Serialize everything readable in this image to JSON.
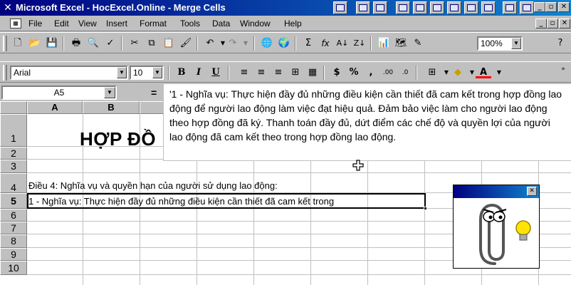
{
  "window": {
    "title": "Microsoft Excel - HocExcel.Online - Merge Cells"
  },
  "menu": {
    "items": [
      "File",
      "Edit",
      "View",
      "Insert",
      "Format",
      "Tools",
      "Data",
      "Window",
      "Help"
    ],
    "accels": [
      "F",
      "E",
      "V",
      "I",
      "o",
      "T",
      "D",
      "W",
      "H"
    ]
  },
  "standard_toolbar": {
    "zoom": "100%"
  },
  "formatting_toolbar": {
    "font_name": "Arial",
    "font_size": "10",
    "bold": "B",
    "italic": "I",
    "underline": "U",
    "currency": "$",
    "percent": "%",
    "comma": ","
  },
  "formula_bar": {
    "name_box": "A5",
    "equals": "="
  },
  "sheet": {
    "columns": [
      "A",
      "B"
    ],
    "rows": [
      "1",
      "2",
      "3",
      "4",
      "5",
      "6",
      "7",
      "8",
      "9",
      "10"
    ],
    "active_row": "5",
    "title_cell": "HỢP ĐỒ",
    "row4_text": "Điều 4: Nghĩa vụ và quyền hạn của người sử dụng lao động:",
    "row5_text": "1 - Nghĩa vụ: Thực hiện đầy đủ những điều kiện cần thiết đã cam kết trong"
  },
  "formula_tooltip": {
    "text": "'1 - Nghĩa vụ: Thực hiện đầy đủ những điều kiện cần thiết đã cam kết trong hợp đồng lao động để người lao động làm việc đạt hiệu quả. Đảm bảo việc làm cho người lao động theo hợp đồng đã ký. Thanh toán đầy đủ, dứt điểm các chế độ và quyền lợi của người lao động đã cam kết theo trong hợp đồng lao động."
  },
  "colors": {
    "title_bar": "#000080",
    "face": "#c0c0c0",
    "sheet_bg": "#ffffff"
  }
}
